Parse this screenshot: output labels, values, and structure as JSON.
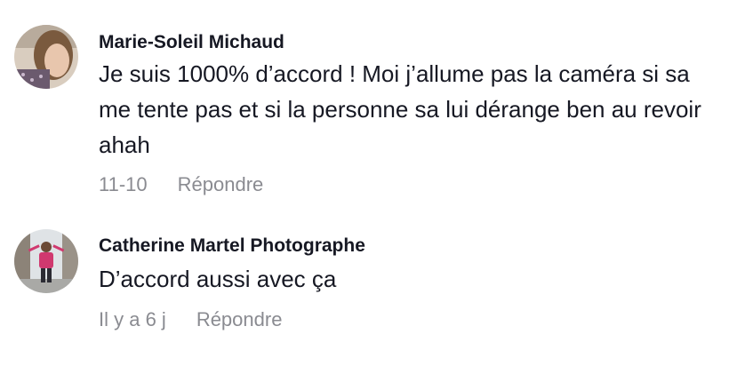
{
  "comments": [
    {
      "author": "Marie-Soleil Michaud",
      "text": "Je suis 1000% d’accord ! Moi j’allume pas la caméra si sa me tente pas et si la personne sa lui dérange ben au revoir ahah",
      "date": "11-10",
      "reply_label": "Répondre"
    },
    {
      "author": "Catherine Martel Photographe",
      "text": "D’accord aussi avec ça",
      "date": "Il y a 6 j",
      "reply_label": "Répondre"
    }
  ]
}
